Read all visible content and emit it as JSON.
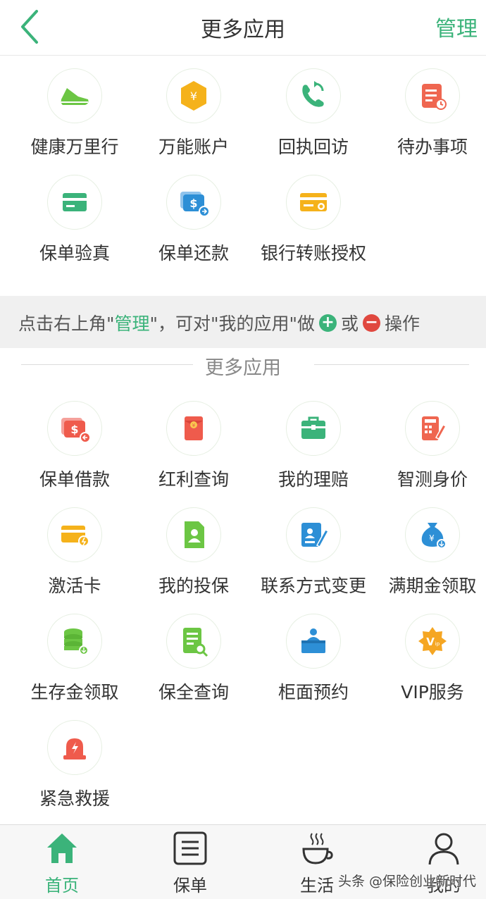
{
  "header": {
    "title": "更多应用",
    "manage_label": "管理"
  },
  "my_apps": [
    {
      "label": "健康万里行",
      "icon": "sneaker-icon",
      "color": "#6cc644"
    },
    {
      "label": "万能账户",
      "icon": "yuan-hexagon-icon",
      "color": "#f5b21b"
    },
    {
      "label": "回执回访",
      "icon": "phone-callback-icon",
      "color": "#3bb37a"
    },
    {
      "label": "待办事项",
      "icon": "todo-list-icon",
      "color": "#ef6650"
    },
    {
      "label": "保单验真",
      "icon": "card-verify-icon",
      "color": "#3bb37a"
    },
    {
      "label": "保单还款",
      "icon": "dollar-repay-icon",
      "color": "#2d8fd6"
    },
    {
      "label": "银行转账授权",
      "icon": "bank-card-icon",
      "color": "#f5b21b"
    }
  ],
  "tip": {
    "prefix": "点击右上角\"",
    "manage": " 管理",
    "middle": "\"，可对\"我的应用\"做",
    "plus": "+",
    "or": "或",
    "minus": "−",
    "suffix": "操作"
  },
  "section_title": "更多应用",
  "more_apps": [
    {
      "label": "保单借款",
      "icon": "dollar-loan-icon",
      "color": "#ef5b4c"
    },
    {
      "label": "红利查询",
      "icon": "red-envelope-icon",
      "color": "#ef5b4c"
    },
    {
      "label": "我的理赔",
      "icon": "briefcase-icon",
      "color": "#3bb37a"
    },
    {
      "label": "智测身价",
      "icon": "calculator-pen-icon",
      "color": "#ef6650"
    },
    {
      "label": "激活卡",
      "icon": "activation-card-icon",
      "color": "#f5b21b"
    },
    {
      "label": "我的投保",
      "icon": "person-document-icon",
      "color": "#6cc644"
    },
    {
      "label": "联系方式变更",
      "icon": "contact-edit-icon",
      "color": "#2d8fd6"
    },
    {
      "label": "满期金领取",
      "icon": "money-bag-icon",
      "color": "#2d8fd6"
    },
    {
      "label": "生存金领取",
      "icon": "coin-stack-icon",
      "color": "#6cc644"
    },
    {
      "label": "保全查询",
      "icon": "document-search-icon",
      "color": "#6cc644"
    },
    {
      "label": "柜面预约",
      "icon": "counter-clerk-icon",
      "color": "#2d8fd6"
    },
    {
      "label": "VIP服务",
      "icon": "vip-badge-icon",
      "color": "#f5a623"
    },
    {
      "label": "紧急救援",
      "icon": "alarm-light-icon",
      "color": "#ef5b4c"
    }
  ],
  "tabbar": [
    {
      "label": "首页",
      "icon": "home-icon",
      "active": true
    },
    {
      "label": "保单",
      "icon": "document-icon",
      "active": false
    },
    {
      "label": "生活",
      "icon": "coffee-cup-icon",
      "active": false
    },
    {
      "label": "我的",
      "icon": "user-icon",
      "active": false
    }
  ],
  "watermark": "头条 @保险创业新时代",
  "colors": {
    "accent": "#3bb37a",
    "remove": "#e0483f"
  }
}
